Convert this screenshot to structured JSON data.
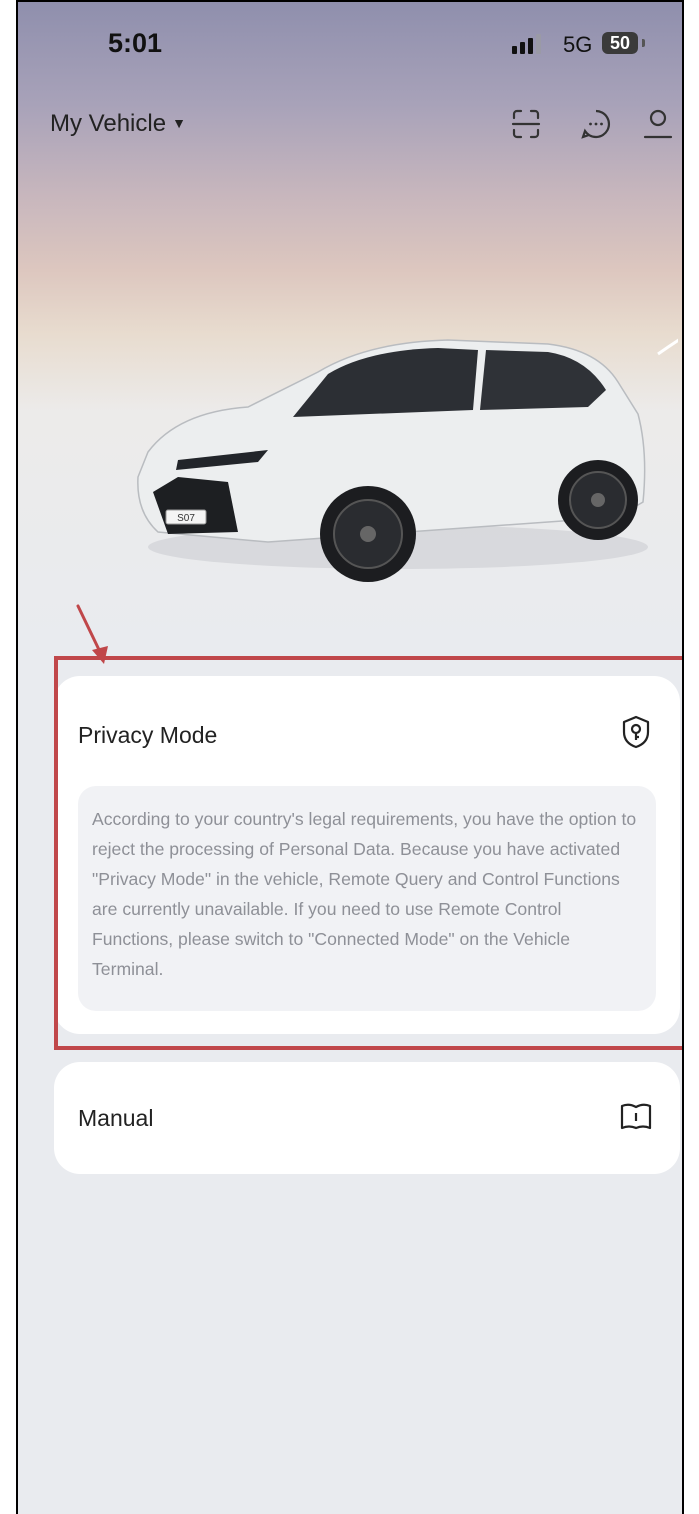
{
  "status_bar": {
    "time": "5:01",
    "network": "5G",
    "battery": "50"
  },
  "header": {
    "vehicle_label": "My Vehicle",
    "icons": [
      "scan-icon",
      "message-icon",
      "profile-icon"
    ]
  },
  "vehicle": {
    "badge": "S07"
  },
  "privacy_card": {
    "title": "Privacy Mode",
    "icon": "privacy-lock-icon",
    "notice": "According to your country's legal requirements, you have the option to reject the processing of Personal Data. Because you have activated \"Privacy Mode\" in the vehicle, Remote Query and Control Functions are currently unavailable. If you need to use Remote Control Functions, please switch to \"Connected Mode\" on the Vehicle Terminal."
  },
  "manual_card": {
    "title": "Manual",
    "icon": "book-icon"
  },
  "colors": {
    "highlight": "#c0474a",
    "background": "#e9ebef"
  }
}
